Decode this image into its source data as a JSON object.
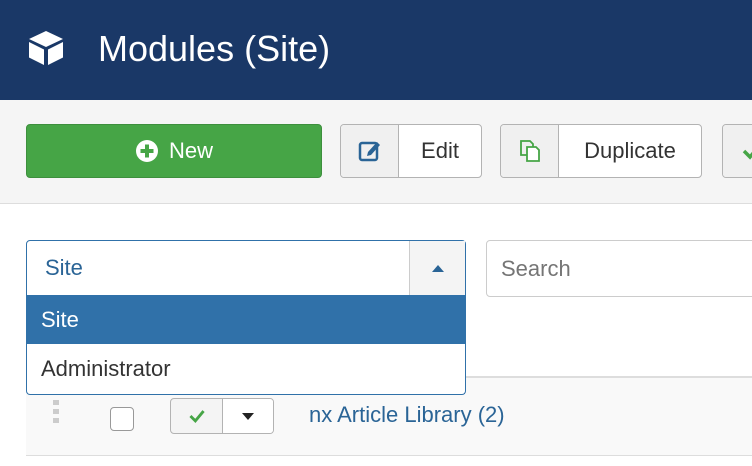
{
  "header": {
    "title": "Modules (Site)",
    "icon": "cube-icon"
  },
  "toolbar": {
    "new_label": "New",
    "edit_label": "Edit",
    "duplicate_label": "Duplicate"
  },
  "filter": {
    "client_select": {
      "selected": "Site",
      "options": [
        "Site",
        "Administrator"
      ]
    },
    "search_placeholder": "Search"
  },
  "table": {
    "rows": [
      {
        "title": "nx Article Library (2)",
        "published": true
      }
    ]
  },
  "colors": {
    "header_bg": "#1a3867",
    "new_button": "#46a546",
    "accent": "#3071a9",
    "link": "#2a6496"
  }
}
